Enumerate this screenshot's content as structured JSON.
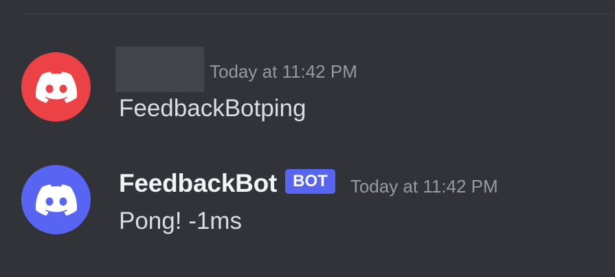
{
  "colors": {
    "background": "#313338",
    "avatar_user": "#ed4245",
    "avatar_bot": "#5865f2",
    "bot_tag": "#5865f2",
    "username": "#f2f3f5",
    "timestamp": "#949ba4",
    "message_text": "#dbdee1"
  },
  "messages": [
    {
      "avatar_icon": "discord-logo-icon",
      "author": "",
      "author_redacted": true,
      "timestamp": "Today at 11:42 PM",
      "content": "FeedbackBotping"
    },
    {
      "avatar_icon": "discord-logo-icon",
      "author": "FeedbackBot",
      "bot_tag": "BOT",
      "timestamp": "Today at 11:42 PM",
      "content": "Pong! -1ms"
    }
  ]
}
